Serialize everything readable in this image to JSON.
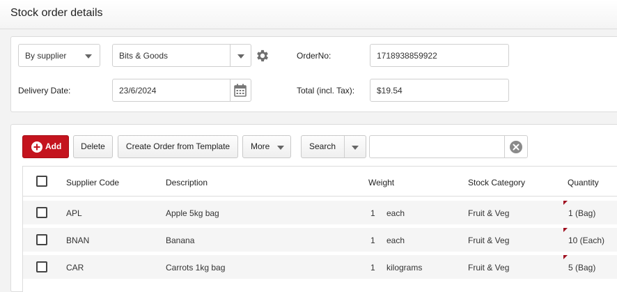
{
  "page": {
    "title": "Stock order details"
  },
  "order_header": {
    "mode_select": {
      "value": "By supplier"
    },
    "supplier_select": {
      "value": "Bits & Goods"
    },
    "order_no": {
      "label": "OrderNo:",
      "value": "1718938859922"
    },
    "delivery_date": {
      "label": "Delivery Date:",
      "value": "23/6/2024"
    },
    "total": {
      "label": "Total (incl. Tax):",
      "value": "$19.54"
    }
  },
  "toolbar": {
    "add_label": "Add",
    "delete_label": "Delete",
    "create_from_template_label": "Create Order from Template",
    "more_label": "More",
    "search_mode_label": "Search",
    "search_value": ""
  },
  "grid": {
    "columns": {
      "supplier_code": "Supplier Code",
      "description": "Description",
      "weight": "Weight",
      "stock_category": "Stock Category",
      "quantity": "Quantity"
    },
    "rows": [
      {
        "code": "APL",
        "description": "Apple 5kg bag",
        "weight_qty": "1",
        "weight_unit": "each",
        "category": "Fruit & Veg",
        "quantity": "1 (Bag)"
      },
      {
        "code": "BNAN",
        "description": "Banana",
        "weight_qty": "1",
        "weight_unit": "each",
        "category": "Fruit & Veg",
        "quantity": "10 (Each)"
      },
      {
        "code": "CAR",
        "description": "Carrots 1kg bag",
        "weight_qty": "1",
        "weight_unit": "kilograms",
        "category": "Fruit & Veg",
        "quantity": "5 (Bag)"
      }
    ]
  },
  "colors": {
    "accent": "#c4141e",
    "dirty_flag": "#a01020"
  }
}
